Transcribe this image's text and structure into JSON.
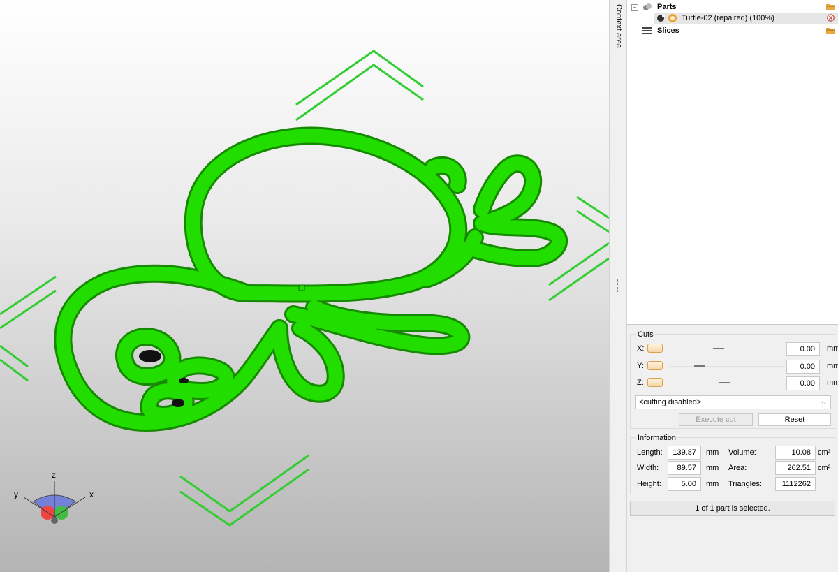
{
  "tree": {
    "parts_label": "Parts",
    "part_name": "Turtle-02 (repaired) (100%)",
    "slices_label": "Slices"
  },
  "context_area_label": "Context area",
  "cuts": {
    "title": "Cuts",
    "rows": [
      {
        "axis": "X:",
        "value": "0.00",
        "unit": "mm",
        "slider_fraction": 0.55
      },
      {
        "axis": "Y:",
        "value": "0.00",
        "unit": "mm",
        "slider_fraction": 0.33
      },
      {
        "axis": "Z:",
        "value": "0.00",
        "unit": "mm",
        "slider_fraction": 0.6
      }
    ],
    "mode_value": "<cutting disabled>",
    "execute_label": "Execute cut",
    "reset_label": "Reset"
  },
  "information": {
    "title": "Information",
    "length_label": "Length:",
    "length_value": "139.87",
    "length_unit": "mm",
    "width_label": "Width:",
    "width_value": "89.57",
    "width_unit": "mm",
    "height_label": "Height:",
    "height_value": "5.00",
    "height_unit": "mm",
    "volume_label": "Volume:",
    "volume_value": "10.08",
    "volume_unit": "cm³",
    "area_label": "Area:",
    "area_value": "262.51",
    "area_unit": "cm²",
    "triangles_label": "Triangles:",
    "triangles_value": "1112262"
  },
  "status": "1 of 1 part is selected.",
  "axes": {
    "x": "x",
    "y": "y",
    "z": "z"
  },
  "colors": {
    "model_green": "#22dd00",
    "arrow_green": "#33cc33",
    "accent_orange": "#e0a050"
  }
}
